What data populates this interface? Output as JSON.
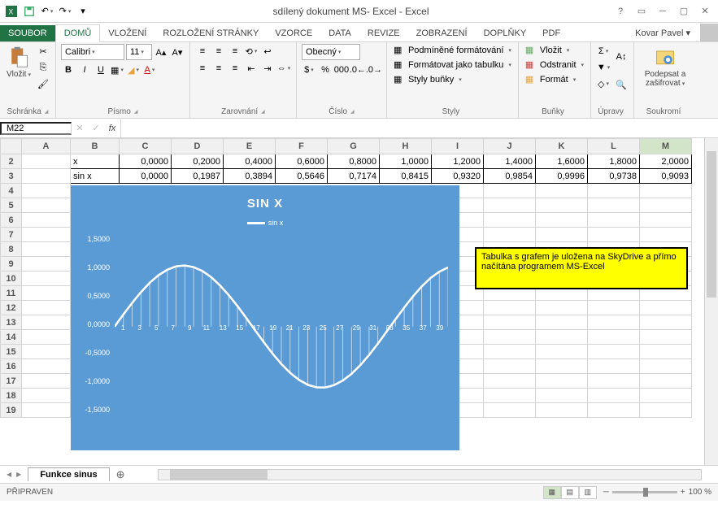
{
  "app": {
    "title": "sdílený dokument MS- Excel - Excel"
  },
  "tabs": {
    "file": "SOUBOR",
    "list": [
      "DOMŮ",
      "VLOŽENÍ",
      "ROZLOŽENÍ STRÁNKY",
      "VZORCE",
      "DATA",
      "REVIZE",
      "ZOBRAZENÍ",
      "DOPLŇKY",
      "PDF"
    ],
    "active": "DOMŮ",
    "user": "Kovar Pavel"
  },
  "ribbon": {
    "clipboard": {
      "label": "Schránka",
      "paste": "Vložit"
    },
    "font": {
      "label": "Písmo",
      "name": "Calibri",
      "size": "11"
    },
    "align": {
      "label": "Zarovnání"
    },
    "number": {
      "label": "Číslo",
      "format": "Obecný"
    },
    "styles": {
      "label": "Styly",
      "cond": "Podmíněné formátování",
      "table": "Formátovat jako tabulku",
      "cell": "Styly buňky"
    },
    "cells": {
      "label": "Buňky",
      "insert": "Vložit",
      "delete": "Odstranit",
      "format": "Formát"
    },
    "editing": {
      "label": "Úpravy"
    },
    "privacy": {
      "label": "Soukromí",
      "sign": "Podepsat a zašifrovat"
    }
  },
  "namebox": "M22",
  "columns": [
    "A",
    "B",
    "C",
    "D",
    "E",
    "F",
    "G",
    "H",
    "I",
    "J",
    "K",
    "L",
    "M"
  ],
  "table": {
    "rows": [
      {
        "r": "2",
        "label": "x",
        "vals": [
          "0,0000",
          "0,2000",
          "0,4000",
          "0,6000",
          "0,8000",
          "1,0000",
          "1,2000",
          "1,4000",
          "1,6000",
          "1,8000",
          "2,0000"
        ]
      },
      {
        "r": "3",
        "label": "sin x",
        "vals": [
          "0,0000",
          "0,1987",
          "0,3894",
          "0,5646",
          "0,7174",
          "0,8415",
          "0,9320",
          "0,9854",
          "0,9996",
          "0,9738",
          "0,9093"
        ]
      }
    ]
  },
  "emptyRows": [
    "4",
    "5",
    "6",
    "7",
    "8",
    "9",
    "10",
    "11",
    "12",
    "13",
    "14",
    "15",
    "16",
    "17",
    "18",
    "19"
  ],
  "chart_data": {
    "type": "line",
    "title": "SIN X",
    "series": [
      {
        "name": "sin x"
      }
    ],
    "ylim": [
      -1.5,
      1.5
    ],
    "yticks": [
      "1,5000",
      "1,0000",
      "0,5000",
      "0,0000",
      "-0,5000",
      "-1,0000",
      "-1,5000"
    ],
    "x": [
      1,
      3,
      5,
      7,
      9,
      11,
      13,
      15,
      17,
      19,
      21,
      23,
      25,
      27,
      29,
      31,
      33,
      35,
      37,
      39
    ],
    "values": [
      0,
      0.39,
      0.72,
      0.93,
      1.0,
      0.91,
      0.68,
      0.33,
      -0.06,
      -0.44,
      -0.76,
      -0.96,
      -0.99,
      -0.88,
      -0.63,
      -0.27,
      0.12,
      0.49,
      0.79,
      0.97
    ]
  },
  "note": "Tabulka s grafem je uložena na SkyDrive a přímo načítána programem MS-Excel",
  "sheet": {
    "name": "Funkce sinus"
  },
  "status": {
    "ready": "PŘIPRAVEN",
    "zoom": "100 %"
  }
}
